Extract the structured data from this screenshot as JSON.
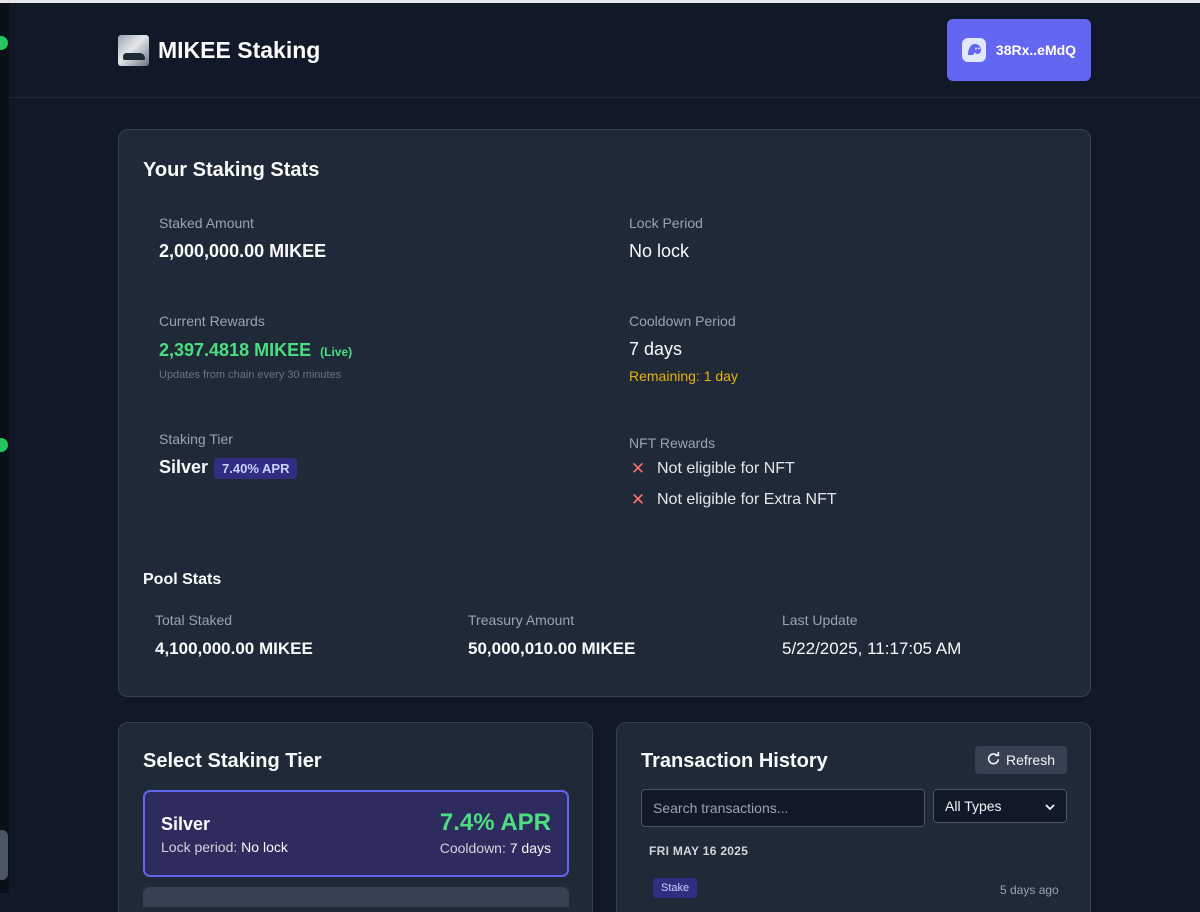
{
  "header": {
    "brand_title": "MIKEE Staking",
    "logo_icon": "mikee-logo",
    "wallet_label": "38Rx..eMdQ",
    "wallet_icon": "ghost-wallet-icon",
    "accent_color": "#6366f1"
  },
  "staking_stats": {
    "title": "Your Staking Stats",
    "staked_amount": {
      "label": "Staked Amount",
      "value": "2,000,000.00 MIKEE"
    },
    "lock_period": {
      "label": "Lock Period",
      "value": "No lock"
    },
    "current_rewards": {
      "label": "Current Rewards",
      "value": "2,397.4818 MIKEE",
      "live_tag": "(Live)",
      "note": "Updates from chain every 30 minutes"
    },
    "cooldown_period": {
      "label": "Cooldown Period",
      "value": "7 days",
      "remaining": "Remaining: 1 day"
    },
    "staking_tier": {
      "label": "Staking Tier",
      "value": "Silver",
      "apr_badge": "7.40% APR"
    },
    "nft_rewards": {
      "label": "NFT Rewards",
      "items": [
        {
          "text": "Not eligible for NFT",
          "icon": "x-icon"
        },
        {
          "text": "Not eligible for Extra NFT",
          "icon": "x-icon"
        }
      ]
    }
  },
  "pool_stats": {
    "title": "Pool Stats",
    "total_staked": {
      "label": "Total Staked",
      "value": "4,100,000.00 MIKEE"
    },
    "treasury_amount": {
      "label": "Treasury Amount",
      "value": "50,000,010.00 MIKEE"
    },
    "last_update": {
      "label": "Last Update",
      "value": "5/22/2025, 11:17:05 AM"
    }
  },
  "select_tier": {
    "title": "Select Staking Tier",
    "tiers": [
      {
        "name": "Silver",
        "apr": "7.4% APR",
        "lock_label": "Lock period:",
        "lock_value": "No lock",
        "cooldown_label": "Cooldown:",
        "cooldown_value": "7 days"
      }
    ]
  },
  "transactions": {
    "title": "Transaction History",
    "refresh_label": "Refresh",
    "refresh_icon": "refresh-icon",
    "search_placeholder": "Search transactions...",
    "type_filter": "All Types",
    "groups": [
      {
        "date": "FRI MAY 16 2025",
        "items": [
          {
            "type": "Stake",
            "time": "5 days ago"
          }
        ]
      }
    ]
  },
  "colors": {
    "background": "#111827",
    "card": "#1f2937",
    "reward_green": "#4ade80",
    "warning_yellow": "#eab308",
    "error_red": "#f87171"
  }
}
